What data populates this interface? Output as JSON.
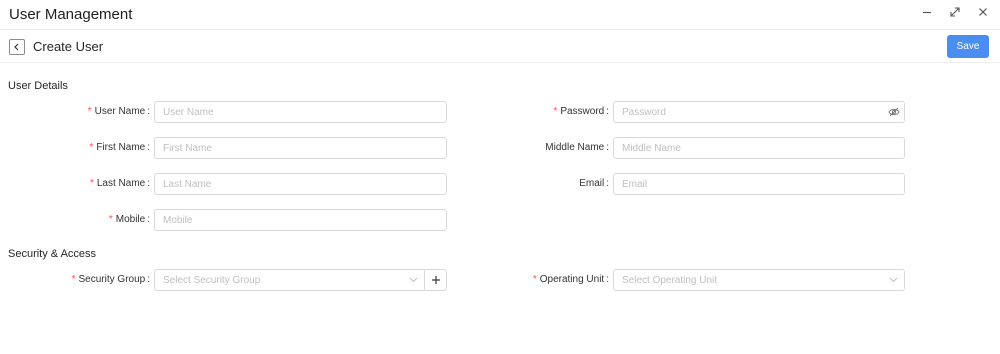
{
  "app": {
    "title": "User Management"
  },
  "window_controls": {
    "minimize": "minimize-icon",
    "maximize": "expand-icon",
    "close": "close-icon"
  },
  "header": {
    "page_title": "Create User",
    "back_icon": "chevron-left-icon",
    "save_label": "Save",
    "accent_color": "#4a8ff0"
  },
  "sections": {
    "user_details": "User Details",
    "security_access": "Security & Access"
  },
  "fields": {
    "user_name": {
      "label": "User Name",
      "placeholder": "User Name",
      "required": true
    },
    "password": {
      "label": "Password",
      "placeholder": "Password",
      "required": true,
      "suffix_icon": "eye-off-icon"
    },
    "first_name": {
      "label": "First Name",
      "placeholder": "First Name",
      "required": true
    },
    "middle_name": {
      "label": "Middle Name",
      "placeholder": "Middle Name",
      "required": false
    },
    "last_name": {
      "label": "Last Name",
      "placeholder": "Last Name",
      "required": true
    },
    "email": {
      "label": "Email",
      "placeholder": "Email",
      "required": false
    },
    "mobile": {
      "label": "Mobile",
      "placeholder": "Mobile",
      "required": true
    },
    "security_group": {
      "label": "Security Group",
      "placeholder": "Select Security Group",
      "required": true
    },
    "operating_unit": {
      "label": "Operating Unit",
      "placeholder": "Select Operating Unit",
      "required": true
    }
  },
  "required_marker": "*",
  "colon": ":",
  "required_color": "#ff4d4f"
}
